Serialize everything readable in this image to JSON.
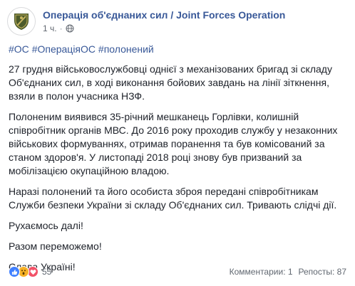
{
  "post": {
    "page_name": "Операція об'єднаних сил / Joint Forces Operation",
    "time": "1 ч.",
    "separator": "·",
    "hashtags": [
      "#ОС",
      "#ОпераціяОС",
      "#полонений"
    ],
    "paragraphs": [
      "27 грудня військовослужбовці однієї з механізованих бригад зі складу Об'єднаних сил, в ході виконання бойових завдань на лінії зіткнення, взяли в полон учасника НЗФ.",
      "Полоненим виявився 35-річний мешканець Горлівки, колишній співробітник органів МВС. До 2016 року проходив службу у незаконних військових формуваннях, отримав поранення та був комісований за станом здоров'я. У листопаді 2018 році знову був призваний за мобілізацією окупаційною владою.",
      "Наразі полонений та його особиста зброя передані співробітникам Служби безпеки України зі складу Об'єднаних сил. Тривають слідчі дії.",
      "Рухаємось далі!",
      "Разом переможемо!",
      "Слава Україні!"
    ]
  },
  "footer": {
    "reaction_count": "55",
    "comments": "Комментарии: 1",
    "shares": "Репосты: 87"
  },
  "colors": {
    "link": "#385898",
    "like": "#4080ff",
    "wow": "#f7b125",
    "love": "#f25268",
    "avatar_emblem": "#4b5a2a"
  },
  "icons": [
    "avatar-emblem",
    "globe-icon",
    "like-reaction-icon",
    "wow-reaction-icon",
    "love-reaction-icon"
  ]
}
